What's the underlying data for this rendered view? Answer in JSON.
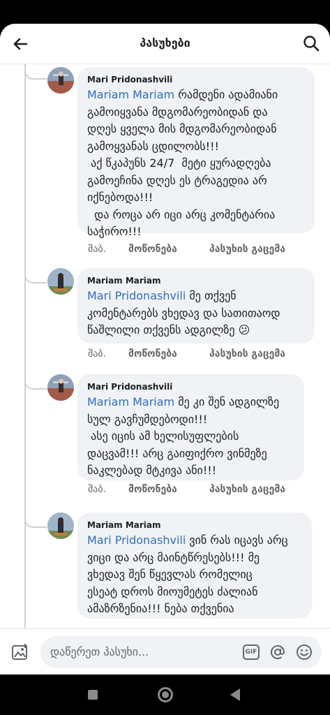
{
  "header": {
    "title": "პასუხები"
  },
  "comments": [
    {
      "author": "Mari Pridonashvili",
      "mention": "Mariam Mariam",
      "text": " რამდენი ადამიანი\nგამოიყვანა მდგომარეობიდან და\nდღეს ყველა მის მდგომარეობიდან\nგამოყვანას ცდილობს!!!\n აქ წკაპუნს 24/7  მეტი ყურადღება\nგამოეჩინა დღეს ეს ტრაგედია არ\nიქნებოდა!!!\n  და როცა არ იცი არც კომენტარია\nსაჭირო!!!",
      "time": "შაბ.",
      "like": "მოწონება",
      "reply": "პასუხის გაცემა"
    },
    {
      "author": "Mariam Mariam",
      "mention": "Mari Pridonashvili",
      "text": " მე თქვენ\nკომენტარებს ვხედავ და სათითაოდ\nწაშლილი თქვენს ადგილზე 😕",
      "time": "შაბ.",
      "like": "მოწონება",
      "reply": "პასუხის გაცემა"
    },
    {
      "author": "Mari Pridonashvili",
      "mention": "Mariam Mariam",
      "text": " მე კი შენ ადგილზე\nსულ გავჩუმდებოდი!!!\n ასე იცის ამ ხელისუფლების\nდაცვამ!!! არც გაიფიქრო ვინმეზე\nნაკლებად მტკივა ანი!!!",
      "time": "შაბ.",
      "like": "მოწონება",
      "reply": "პასუხის გაცემა"
    },
    {
      "author": "Mariam Mariam",
      "mention": "Mari Pridonashvili",
      "text": " ვინ რას იცავს არც\nვიცი და არც მაინტწრესებს!!! მე\nვხედავ შენ წყევლას რომელიც\nესეატ დროს მიოუმეტეს ძალიან\nამაზრზენია!!! ნება თქვენია"
    }
  ],
  "composer": {
    "placeholder": "დაწერეთ პასუხი...",
    "gif_label": "GIF"
  },
  "icons": {
    "back": "arrow-left-icon",
    "search": "search-icon",
    "photo": "photo-icon",
    "at": "at-sign-icon",
    "emoji": "smiley-icon"
  }
}
